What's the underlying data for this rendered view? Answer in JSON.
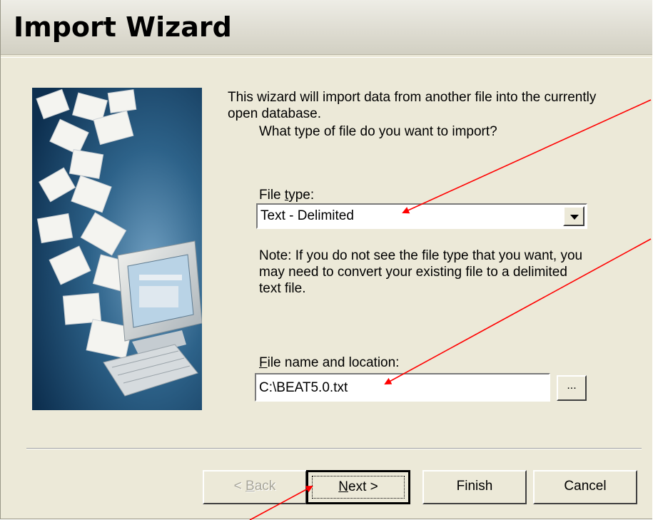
{
  "window": {
    "title": "Import Wizard"
  },
  "intro_text": "This wizard will import data from another file into the currently open database.",
  "question_text": "What type of file do you want to import?",
  "file_type": {
    "label_pre": "File ",
    "label_accel": "t",
    "label_post": "ype:",
    "selected_value": "Text - Delimited"
  },
  "note_text": "Note:  If you do not see the file type that you want, you may need to convert your existing file to a delimited text file.",
  "file_name": {
    "label_accel": "F",
    "label_post": "ile name and location:",
    "value": "C:\\BEAT5.0.txt",
    "browse_label": "..."
  },
  "buttons": {
    "back_pre": "< ",
    "back_accel": "B",
    "back_post": "ack",
    "next_accel": "N",
    "next_post": "ext >",
    "finish": "Finish",
    "cancel": "Cancel"
  },
  "colors": {
    "dialog_bg": "#ece9d8",
    "annotation_arrow": "#ff0000",
    "art_blue": "#1c4a72"
  }
}
